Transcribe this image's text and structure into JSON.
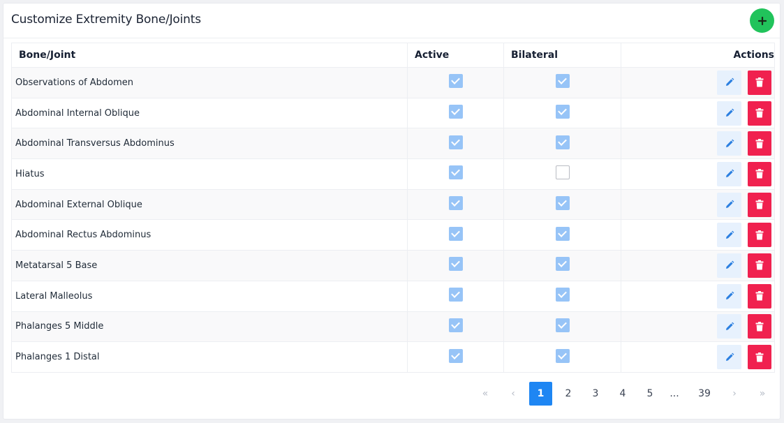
{
  "title": "Customize Extremity Bone/Joints",
  "colors": {
    "add": "#21c35b",
    "checked": "#97c4f7",
    "edit_bg": "#e7f1fd",
    "delete": "#f0214f",
    "page_current": "#1e86f3"
  },
  "icons": {
    "add": "plus-icon",
    "edit": "pencil-icon",
    "delete": "trash-icon"
  },
  "columns": {
    "name": "Bone/Joint",
    "active": "Active",
    "bilateral": "Bilateral",
    "actions": "Actions"
  },
  "rows": [
    {
      "name": "Observations of Abdomen",
      "active": true,
      "bilateral": true
    },
    {
      "name": "Abdominal Internal Oblique",
      "active": true,
      "bilateral": true
    },
    {
      "name": "Abdominal Transversus Abdominus",
      "active": true,
      "bilateral": true
    },
    {
      "name": "Hiatus",
      "active": true,
      "bilateral": false
    },
    {
      "name": "Abdominal External Oblique",
      "active": true,
      "bilateral": true
    },
    {
      "name": "Abdominal Rectus Abdominus",
      "active": true,
      "bilateral": true
    },
    {
      "name": "Metatarsal 5 Base",
      "active": true,
      "bilateral": true
    },
    {
      "name": "Lateral Malleolus",
      "active": true,
      "bilateral": true
    },
    {
      "name": "Phalanges 5 Middle",
      "active": true,
      "bilateral": true
    },
    {
      "name": "Phalanges 1 Distal",
      "active": true,
      "bilateral": true
    }
  ],
  "pagination": {
    "first": "«",
    "prev": "‹",
    "next": "›",
    "last": "»",
    "pages": [
      "1",
      "2",
      "3",
      "4",
      "5",
      "...",
      "39"
    ],
    "current": "1"
  }
}
